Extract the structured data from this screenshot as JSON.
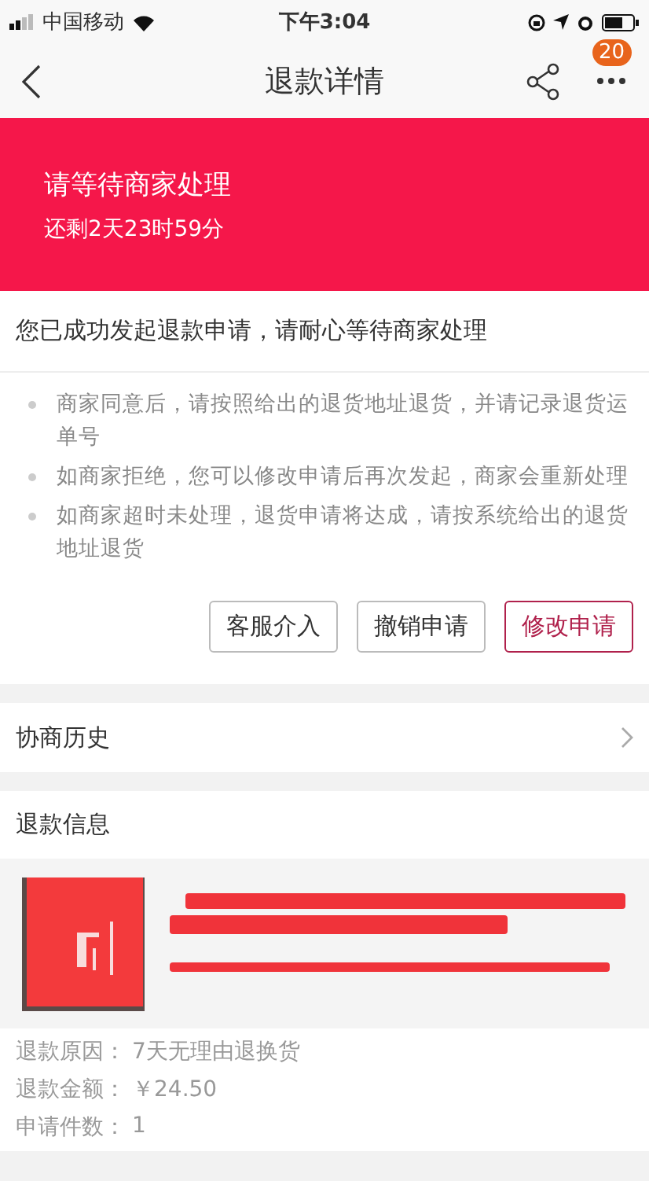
{
  "status_bar": {
    "carrier": "中国移动",
    "time": "下午3:04"
  },
  "nav": {
    "title": "退款详情",
    "badge": "20"
  },
  "banner": {
    "title": "请等待商家处理",
    "countdown": "还剩2天23时59分"
  },
  "message": "您已成功发起退款申请，请耐心等待商家处理",
  "tips": [
    "商家同意后，请按照给出的退货地址退货，并请记录退货运单号",
    "如商家拒绝，您可以修改申请后再次发起，商家会重新处理",
    "如商家超时未处理，退货申请将达成，请按系统给出的退货地址退货"
  ],
  "buttons": [
    {
      "label": "客服介入",
      "kind": "plain"
    },
    {
      "label": "撤销申请",
      "kind": "plain"
    },
    {
      "label": "修改申请",
      "kind": "primary"
    }
  ],
  "history": {
    "label": "协商历史"
  },
  "refund_info": {
    "title": "退款信息",
    "fields": [
      {
        "label": "退款原因：",
        "value": "7天无理由退换货"
      },
      {
        "label": "退款金额：",
        "value": "￥24.50"
      },
      {
        "label": "申请件数：",
        "value": "1"
      }
    ]
  }
}
